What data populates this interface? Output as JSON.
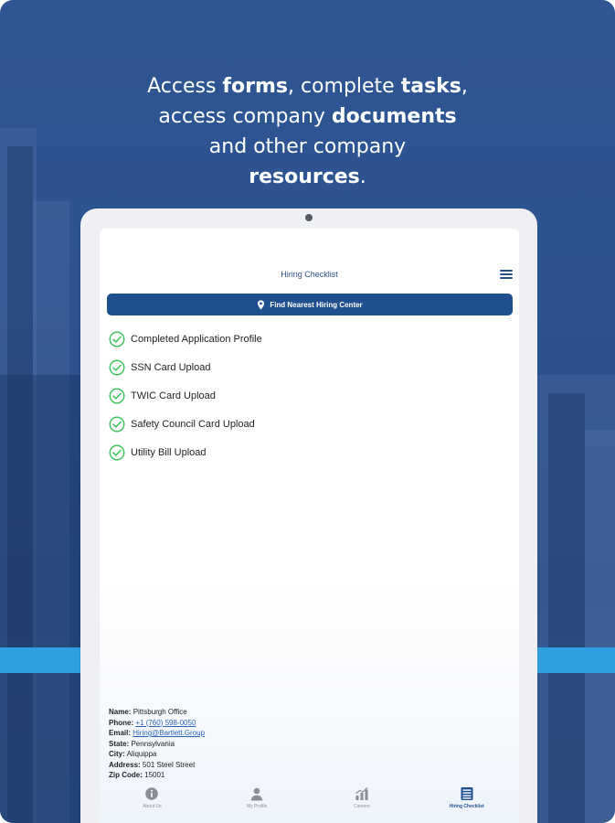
{
  "headline": {
    "line1_a": "Access ",
    "line1_b": "forms",
    "line1_c": ", complete ",
    "line1_d": "tasks",
    "line1_e": ",",
    "line2_a": "access company ",
    "line2_b": "documents",
    "line3": "and other company",
    "line4_a": "resources",
    "line4_b": "."
  },
  "app": {
    "title": "Hiring Checklist",
    "find_button": "Find Nearest Hiring Center"
  },
  "checklist": [
    {
      "label": "Completed Application Profile",
      "done": true
    },
    {
      "label": "SSN Card Upload",
      "done": true
    },
    {
      "label": "TWIC Card Upload",
      "done": true
    },
    {
      "label": "Safety Council Card Upload",
      "done": true
    },
    {
      "label": "Utility Bill Upload",
      "done": true
    }
  ],
  "office": {
    "name_key": "Name:",
    "name_val": "Pittsburgh Office",
    "phone_key": "Phone:",
    "phone_val": "+1 (760) 598-0050",
    "email_key": "Email:",
    "email_val": "Hiring@Bartlett.Group",
    "state_key": "State:",
    "state_val": "Pennsylvania",
    "city_key": "City:",
    "city_val": "Aliquippa",
    "address_key": "Address:",
    "address_val": "501 Steel Street",
    "zip_key": "Zip Code:",
    "zip_val": "15001"
  },
  "tabs": [
    {
      "label": "About Us",
      "icon": "info-icon",
      "active": false
    },
    {
      "label": "My Profile",
      "icon": "person-icon",
      "active": false
    },
    {
      "label": "Careers",
      "icon": "chart-icon",
      "active": false
    },
    {
      "label": "Hiring Checklist",
      "icon": "checklist-icon",
      "active": true
    }
  ],
  "colors": {
    "background": "#2c5390",
    "stripe": "#2f9fe0",
    "primary": "#1f4f8f",
    "check": "#3cc25a"
  }
}
